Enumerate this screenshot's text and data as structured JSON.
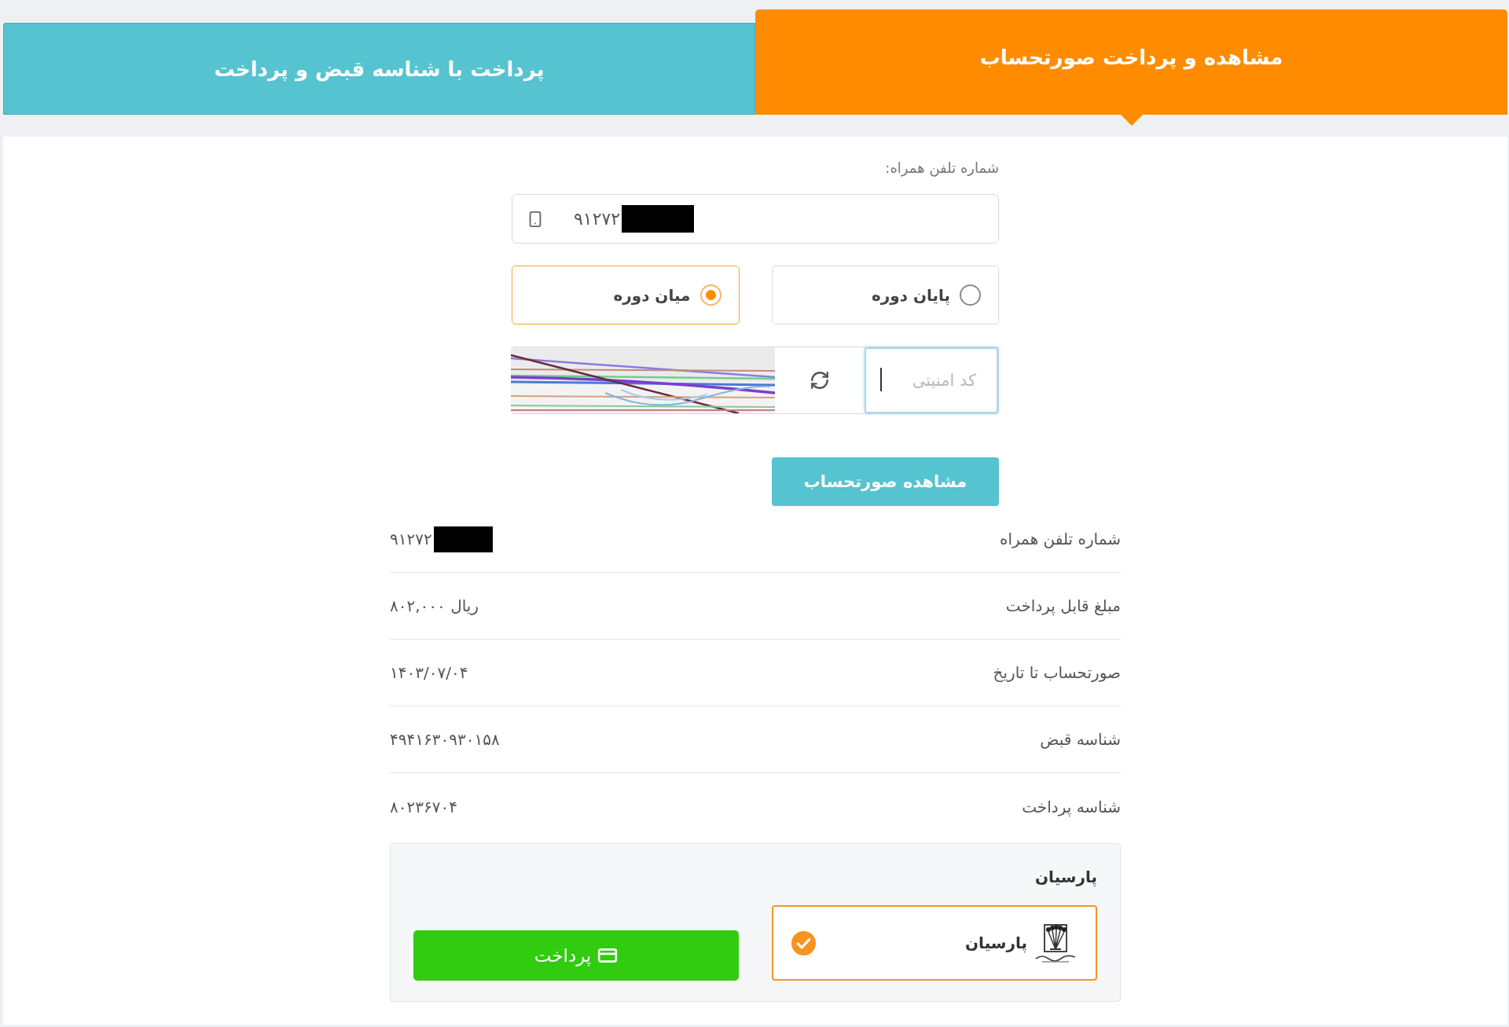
{
  "tabs": [
    {
      "label": "مشاهده و پرداخت صورتحساب",
      "selected": true
    },
    {
      "label": "پرداخت با شناسه قبض و پرداخت",
      "selected": false
    }
  ],
  "bill_form": {
    "phone": {
      "label": "شماره تلفن همراه:",
      "value": "۹۱۲۷۲",
      "redacted": true
    },
    "period_options": [
      {
        "label": "پایان دوره",
        "selected": false
      },
      {
        "label": "میان دوره",
        "selected": true
      }
    ],
    "captcha": {
      "placeholder": "کد امنیتی",
      "focused": true
    },
    "submit_button": "مشاهده صورتحساب"
  },
  "bill_details": [
    {
      "label": "شماره تلفن همراه",
      "value": "۹۱۲۷۲",
      "redacted": true
    },
    {
      "label": "مبلغ قابل پرداخت",
      "value": "۸۰۲,۰۰۰ ریال",
      "redacted": false
    },
    {
      "label": "صورتحساب تا تاریخ",
      "value": "۱۴۰۳/۰۷/۰۴",
      "redacted": false
    },
    {
      "label": "شناسه قبض",
      "value": "۴۹۴۱۶۳۰۹۳۰۱۵۸",
      "redacted": false
    },
    {
      "label": "شناسه پرداخت",
      "value": "۸۰۲۳۶۷۰۴",
      "redacted": false
    }
  ],
  "payment": {
    "title": "پارسیان",
    "gateways": [
      {
        "name": "پارسیان",
        "selected": true
      }
    ],
    "pay_button": "پرداخت"
  }
}
